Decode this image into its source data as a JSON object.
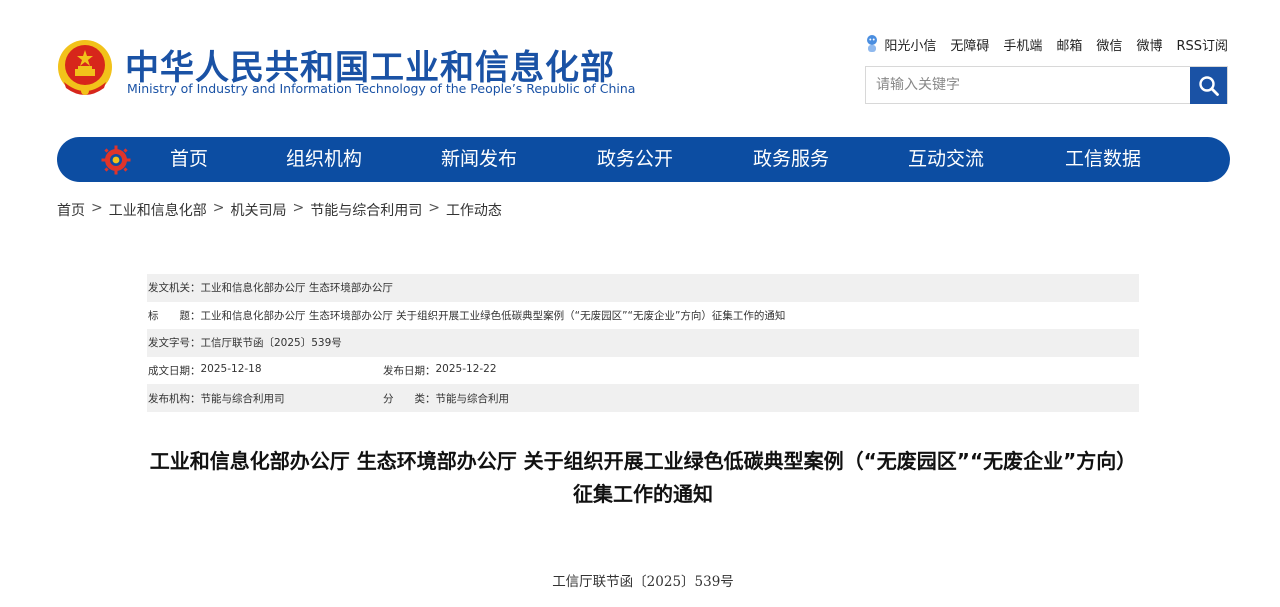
{
  "header": {
    "title": "中华人民共和国工业和信息化部",
    "subtitle": "Ministry of Industry and Information Technology of the People’s Republic of China",
    "links": [
      "阳光小信",
      "无障碍",
      "手机端",
      "邮箱",
      "微信",
      "微博",
      "RSS订阅"
    ],
    "search": {
      "placeholder": "请输入关键字",
      "value": ""
    }
  },
  "nav": {
    "items": [
      "首页",
      "组织机构",
      "新闻发布",
      "政务公开",
      "政务服务",
      "互动交流",
      "工信数据"
    ]
  },
  "breadcrumb": [
    "首页",
    "工业和信息化部",
    "机关司局",
    "节能与综合利用司",
    "工作动态"
  ],
  "meta": {
    "issuer_label": "发文机关：",
    "issuer": "工业和信息化部办公厅 生态环境部办公厅",
    "title_label": "标　　题：",
    "title": "工业和信息化部办公厅 生态环境部办公厅 关于组织开展工业绿色低碳典型案例（“无废园区”“无废企业”方向）征集工作的通知",
    "docno_label": "发文字号：",
    "docno": "工信厅联节函〔2025〕539号",
    "written_label": "成文日期：",
    "written": "2025-12-18",
    "published_label": "发布日期：",
    "published": "2025-12-22",
    "dept_label": "发布机构：",
    "dept": "节能与综合利用司",
    "category_label": "分　　类：",
    "category": "节能与综合利用"
  },
  "article": {
    "title": "工业和信息化部办公厅 生态环境部办公厅 关于组织开展工业绿色低碳典型案例（“无废园区”“无废企业”方向）征集工作的通知",
    "doc_number": "工信厅联节函〔2025〕539号"
  },
  "colors": {
    "brand_blue": "#1a52a5",
    "nav_blue": "#0c4da2",
    "emblem_red": "#d7261b",
    "emblem_gold": "#f2c21a"
  }
}
